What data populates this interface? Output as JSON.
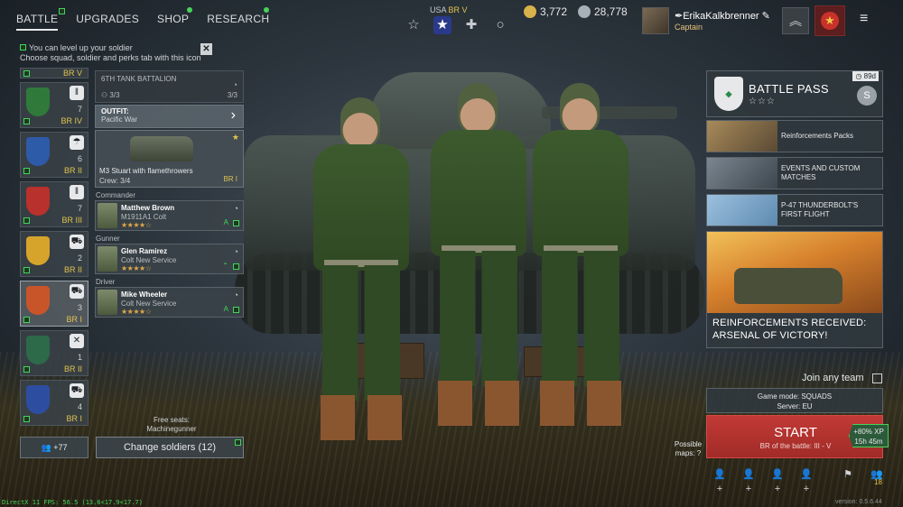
{
  "nav": {
    "tabs": [
      {
        "label": "BATTLE",
        "active": true
      },
      {
        "label": "UPGRADES"
      },
      {
        "label": "SHOP"
      },
      {
        "label": "RESEARCH"
      }
    ]
  },
  "tip": {
    "line1": "You can level up your soldier",
    "line2": "Choose squad, soldier and perks tab with this icon",
    "close": "✕"
  },
  "country": {
    "name": "USA",
    "br": "BR V"
  },
  "mode_icons": [
    "☆",
    "★",
    "✚",
    "○"
  ],
  "currency": {
    "gold": "3,772",
    "silver": "28,778",
    "gold_color": "#d8b24a",
    "silver_color": "#a7b0b6"
  },
  "profile": {
    "name": "ErikaKalkbrenner",
    "rank": "Captain"
  },
  "rank_icon": "︽",
  "menu_icon": "≡",
  "squads": {
    "top_br": "BR V",
    "items": [
      {
        "count": "7",
        "br": "BR IV",
        "cls": "ǁ",
        "emblem_color": "#2f7a3a"
      },
      {
        "count": "6",
        "br": "BR II",
        "cls": "☂",
        "emblem_color": "#2e5ba8"
      },
      {
        "count": "7",
        "br": "BR III",
        "cls": "ǁ",
        "emblem_color": "#b8312c"
      },
      {
        "count": "2",
        "br": "BR II",
        "cls": "⛟",
        "emblem_color": "#d6a42a"
      },
      {
        "count": "3",
        "br": "BR I",
        "cls": "⛟",
        "emblem_color": "#c8552a"
      },
      {
        "count": "1",
        "br": "BR II",
        "cls": "✕",
        "emblem_color": "#2c6a4a"
      },
      {
        "count": "4",
        "br": "BR I",
        "cls": "⛟",
        "emblem_color": "#2d4ea0"
      }
    ],
    "add_count": "+77"
  },
  "squad_panel": {
    "name": "6TH TANK BATTALION",
    "capacity": "3/3",
    "capacity2": "3/3",
    "outfit_label": "OUTFIT:",
    "outfit_value": "Pacific War",
    "vehicle": {
      "name": "M3 Stuart with flamethrowers",
      "crew": "Crew: 3/4",
      "br": "BR I"
    },
    "soldiers": [
      {
        "role": "Commander",
        "name": "Matthew Brown",
        "weapon": "M1911A1 Colt",
        "stars": "★★★★☆"
      },
      {
        "role": "Gunner",
        "name": "Glen Ramirez",
        "weapon": "Colt New Service",
        "stars": "★★★★☆"
      },
      {
        "role": "Driver",
        "name": "Mike Wheeler",
        "weapon": "Colt New Service",
        "stars": "★★★★☆"
      }
    ],
    "free_seats_label": "Free seats:",
    "free_seats_value": "Machinegunner",
    "change_button": "Change soldiers (12)"
  },
  "battle_pass": {
    "title": "BATTLE PASS",
    "stars": "☆☆☆",
    "days": "89d",
    "coin": "S"
  },
  "promos": [
    {
      "text": "Reinforcements Packs",
      "color": "#7a6a4a"
    },
    {
      "text": "EVENTS AND CUSTOM MATCHES",
      "color": "#5a6670"
    },
    {
      "text": "P-47 THUNDERBOLT'S FIRST FLIGHT",
      "color": "#5e8ab0"
    }
  ],
  "big_promo": {
    "line1": "REINFORCEMENTS RECEIVED:",
    "line2": "ARSENAL OF VICTORY!"
  },
  "join": {
    "label": "Join any team"
  },
  "game_mode": {
    "mode": "Game mode: SQUADS",
    "server": "Server: EU"
  },
  "start": {
    "label": "START",
    "sub": "BR of the battle: III - V",
    "xp": "+80% XP",
    "time": "15h 45m"
  },
  "possible_maps": {
    "line1": "Possible",
    "line2": "maps:"
  },
  "bottom_count": "18",
  "debug": {
    "fps": "DirectX 11 FPS: 56.5 (13.6<17.9<17.7)",
    "version": "version: 0.5.6.44"
  }
}
